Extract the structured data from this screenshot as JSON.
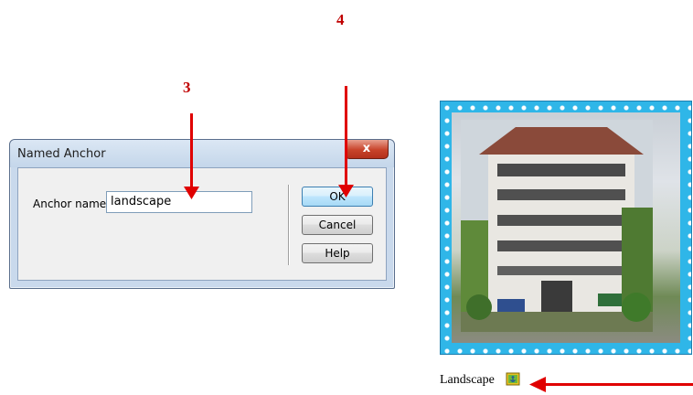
{
  "steps": {
    "three": "3",
    "four": "4"
  },
  "dialog": {
    "title": "Named Anchor",
    "close_label": "x",
    "anchor_label": "Anchor name:",
    "anchor_value": "landscape",
    "ok_label": "OK",
    "cancel_label": "Cancel",
    "help_label": "Help"
  },
  "page": {
    "caption": "Landscape"
  },
  "colors": {
    "annotation": "#e00000",
    "step_number": "#c00000",
    "frame": "#2fb6e8"
  },
  "icons": {
    "anchor": "anchor-icon",
    "close": "close-icon"
  }
}
